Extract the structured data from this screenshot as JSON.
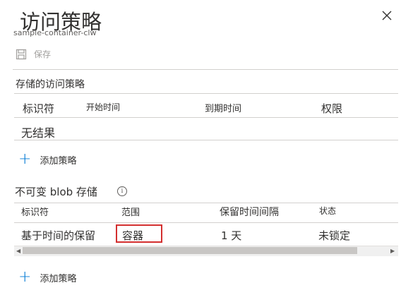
{
  "header": {
    "title": "访问策略",
    "subtitle": "sample-container-clw"
  },
  "toolbar": {
    "save_label": "保存"
  },
  "stored_policies": {
    "section_title": "存储的访问策略",
    "columns": [
      "标识符",
      "开始时间",
      "到期时间",
      "权限"
    ],
    "empty_text": "无结果",
    "add_label": "添加策略"
  },
  "immutable": {
    "section_title": "不可变 blob 存储",
    "info_icon": "ⓘ",
    "columns": [
      "标识符",
      "范围",
      "保留时间间隔",
      "状态"
    ],
    "rows": [
      [
        "基于时间的保留",
        "容器",
        "1 天",
        "未锁定"
      ]
    ],
    "add_label": "添加策略"
  },
  "colors": {
    "accent": "#0078d4",
    "highlight": "#d32f2f"
  }
}
